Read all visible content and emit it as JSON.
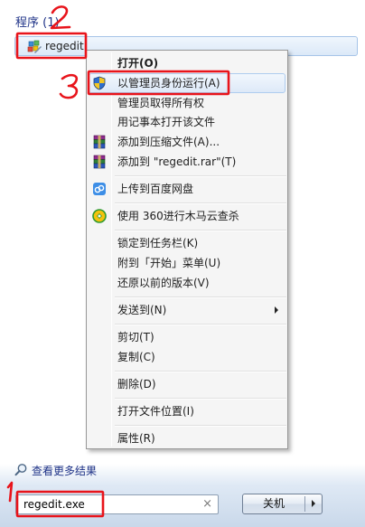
{
  "section": {
    "title": "程序 (1)"
  },
  "program": {
    "name": "regedit"
  },
  "context_menu": {
    "items": [
      {
        "label": "打开(O)"
      },
      {
        "label": "以管理员身份运行(A)"
      },
      {
        "label": "管理员取得所有权"
      },
      {
        "label": "用记事本打开该文件"
      },
      {
        "label": "添加到压缩文件(A)..."
      },
      {
        "label": "添加到 \"regedit.rar\"(T)"
      },
      {
        "label": "上传到百度网盘"
      },
      {
        "label": "使用 360进行木马云查杀"
      },
      {
        "label": "锁定到任务栏(K)"
      },
      {
        "label": "附到「开始」菜单(U)"
      },
      {
        "label": "还原以前的版本(V)"
      },
      {
        "label": "发送到(N)"
      },
      {
        "label": "剪切(T)"
      },
      {
        "label": "复制(C)"
      },
      {
        "label": "删除(D)"
      },
      {
        "label": "打开文件位置(I)"
      },
      {
        "label": "属性(R)"
      }
    ]
  },
  "see_more": {
    "label": "查看更多结果"
  },
  "search": {
    "value": "regedit.exe",
    "clear_symbol": "×"
  },
  "shutdown": {
    "label": "关机"
  },
  "annotation_color": "#e8141b",
  "highlight_color": "#aeccef",
  "icons": {
    "program": "regedit-icon",
    "run_as_admin": "uac-shield-icon",
    "compress": "winrar-icon",
    "baidu": "baidu-netdisk-icon",
    "scan": "360-icon",
    "see_more": "magnifier-icon"
  }
}
